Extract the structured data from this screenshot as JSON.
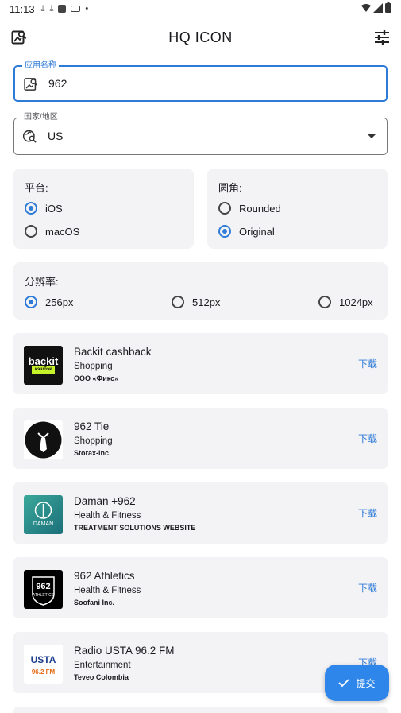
{
  "status": {
    "time": "11:13"
  },
  "appbar": {
    "title": "HQ ICON"
  },
  "app_field": {
    "legend": "应用名称",
    "value": "962"
  },
  "region_field": {
    "legend": "国家/地区",
    "value": "US"
  },
  "platform": {
    "label": "平台:",
    "options": [
      "iOS",
      "macOS"
    ],
    "selected": "iOS"
  },
  "corner": {
    "label": "圆角:",
    "options": [
      "Rounded",
      "Original"
    ],
    "selected": "Original"
  },
  "resolution": {
    "label": "分辨率:",
    "options": [
      "256px",
      "512px",
      "1024px"
    ],
    "selected": "256px"
  },
  "results": [
    {
      "name": "Backit cashback",
      "category": "Shopping",
      "developer": "ООО «Фикс»",
      "download": "下载",
      "icon": "backit-icon",
      "icon_text": "backit",
      "icon_subtext": "кэшбэк"
    },
    {
      "name": "962 Tie",
      "category": "Shopping",
      "developer": "Storax-inc",
      "download": "下载",
      "icon": "tie-icon"
    },
    {
      "name": "Daman +962",
      "category": "Health & Fitness",
      "developer": "TREATMENT SOLUTIONS WEBSITE",
      "download": "下载",
      "icon": "daman-icon",
      "icon_text": "DAMAN"
    },
    {
      "name": "962 Athletics",
      "category": "Health & Fitness",
      "developer": "Soofani Inc.",
      "download": "下载",
      "icon": "athletics-icon",
      "icon_text": "962",
      "icon_subtext": "ATHLETICS"
    },
    {
      "name": "Radio USTA 96.2 FM",
      "category": "Entertainment",
      "developer": "Teveo Colombia",
      "download": "下载",
      "icon": "radio-icon",
      "icon_text": "USTA",
      "icon_subtext": "96.2 FM"
    }
  ],
  "fab": {
    "label": "提交"
  },
  "colors": {
    "accent": "#2f7bd8",
    "fab": "#2f86ea",
    "card": "#f3f3f6"
  }
}
